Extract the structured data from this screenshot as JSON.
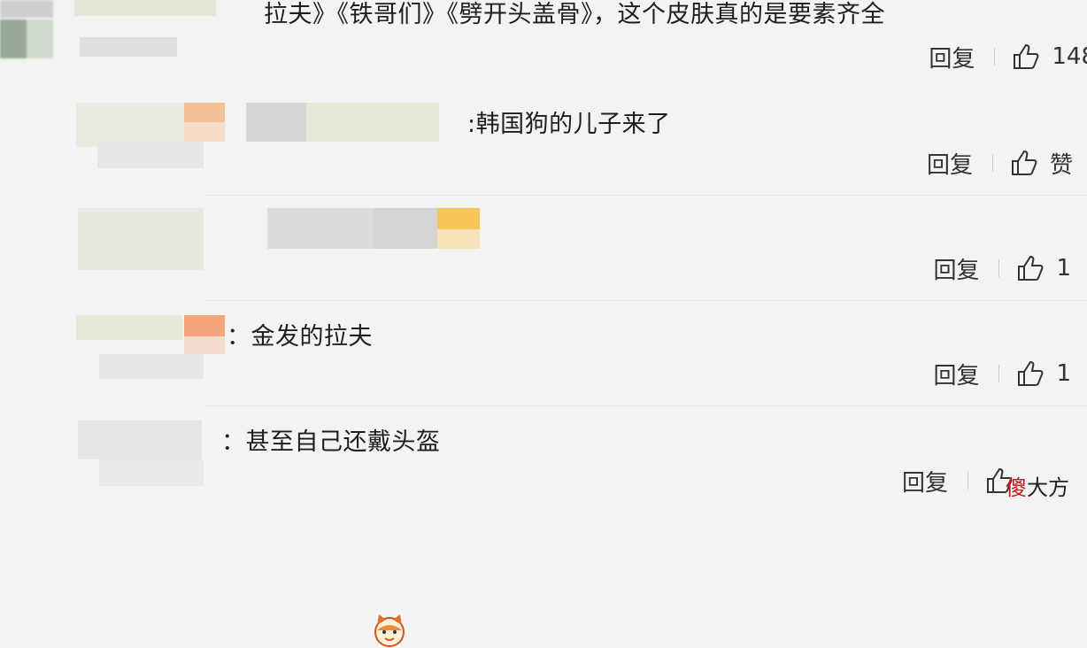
{
  "comments": [
    {
      "text": "拉夫》《铁哥们》《劈开头盖骨》，这个皮肤真的是要素齐全",
      "reply": "回复",
      "likes": "148"
    },
    {
      "text": ":韩国狗的儿子来了",
      "reply": "回复",
      "likes": "赞"
    },
    {
      "text": "",
      "reply": "回复",
      "likes": "1"
    },
    {
      "text": "：金发的拉夫",
      "reply": "回复",
      "likes": "1"
    },
    {
      "text": "：甚至自己还戴头盔",
      "reply": "回复",
      "likes": ""
    }
  ],
  "icons": {
    "like": "thumbs-up-icon",
    "emoji": "cat-face-emoji-icon"
  },
  "watermark": {
    "first": "傻",
    "rest": "大方"
  },
  "colors": {
    "background": "#f3f3f3",
    "text": "#1e1e1e",
    "divider": "#e3e3e3",
    "watermark_accent": "#c8161d"
  }
}
